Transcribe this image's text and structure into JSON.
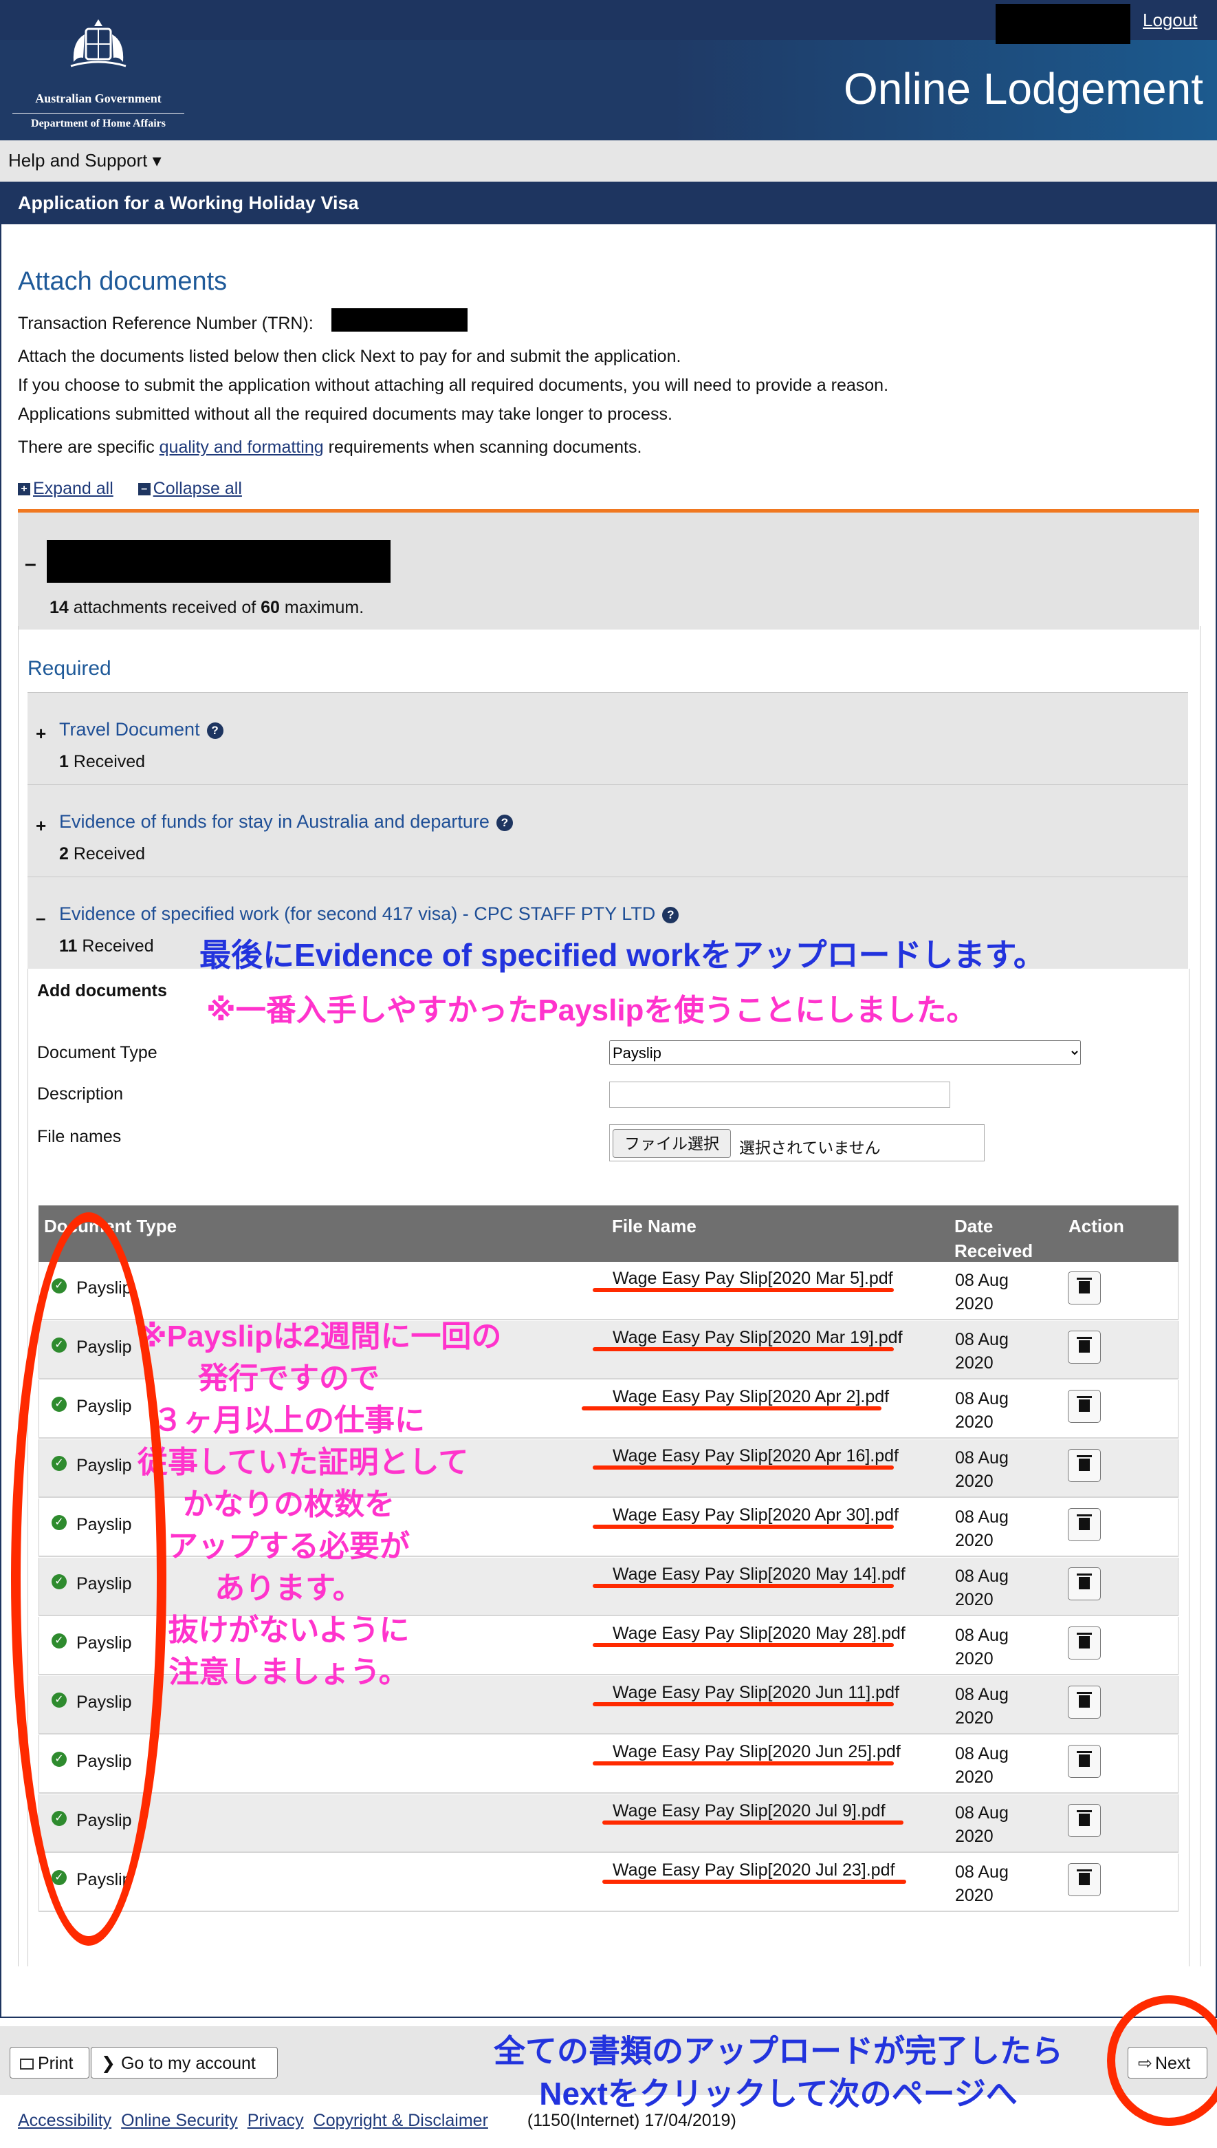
{
  "header": {
    "gov_line1": "Australian Government",
    "gov_line2": "Department of Home Affairs",
    "logout": "Logout",
    "app_title": "Online Lodgement"
  },
  "menu": {
    "help": "Help and Support ▾"
  },
  "appbar": {
    "title": "Application for a Working Holiday Visa"
  },
  "page": {
    "title": "Attach documents",
    "trn_label": "Transaction Reference Number (TRN):",
    "line1": "Attach the documents listed below then click Next to pay for and submit the application.",
    "line2": "If you choose to submit the application without attaching all required documents, you will need to provide a reason.",
    "line3": "Applications submitted without all the required documents may take longer to process.",
    "line4_pre": "There are specific ",
    "line4_link": "quality and formatting",
    "line4_post": " requirements when scanning documents.",
    "expand_all": "Expand all",
    "collapse_all": "Collapse all"
  },
  "applicant": {
    "attach_count": "14",
    "attach_mid": " attachments received of ",
    "attach_max": "60",
    "attach_post": " maximum."
  },
  "required_label": "Required",
  "doc_types": [
    {
      "title": "Travel Document",
      "count": "1",
      "received": " Received",
      "state": "+"
    },
    {
      "title": "Evidence of funds for stay in Australia and departure",
      "count": "2",
      "received": " Received",
      "state": "+"
    },
    {
      "title": "Evidence of specified work (for second 417 visa) - CPC STAFF PTY LTD",
      "count": "11",
      "received": " Received",
      "state": "–"
    }
  ],
  "add_documents": {
    "heading": "Add documents",
    "doc_type_label": "Document Type",
    "doc_type_value": "Payslip",
    "description_label": "Description",
    "file_names_label": "File names",
    "file_button": "ファイル選択",
    "file_status": "選択されていません"
  },
  "table": {
    "headers": {
      "type": "Document Type",
      "file": "File Name",
      "date_1": "Date",
      "date_2": "Received",
      "action": "Action"
    },
    "rows": [
      {
        "type": "Payslip",
        "file": "Wage Easy Pay Slip[2020 Mar 5].pdf",
        "date_1": "08 Aug",
        "date_2": "2020"
      },
      {
        "type": "Payslip",
        "file": "Wage Easy Pay Slip[2020 Mar 19].pdf",
        "date_1": "08 Aug",
        "date_2": "2020"
      },
      {
        "type": "Payslip",
        "file": "Wage Easy Pay Slip[2020 Apr 2].pdf",
        "date_1": "08 Aug",
        "date_2": "2020"
      },
      {
        "type": "Payslip",
        "file": "Wage Easy Pay Slip[2020 Apr 16].pdf",
        "date_1": "08 Aug",
        "date_2": "2020"
      },
      {
        "type": "Payslip",
        "file": "Wage Easy Pay Slip[2020 Apr 30].pdf",
        "date_1": "08 Aug",
        "date_2": "2020"
      },
      {
        "type": "Payslip",
        "file": "Wage Easy Pay Slip[2020 May 14].pdf",
        "date_1": "08 Aug",
        "date_2": "2020"
      },
      {
        "type": "Payslip",
        "file": "Wage Easy Pay Slip[2020 May 28].pdf",
        "date_1": "08 Aug",
        "date_2": "2020"
      },
      {
        "type": "Payslip",
        "file": "Wage Easy Pay Slip[2020 Jun 11].pdf",
        "date_1": "08 Aug",
        "date_2": "2020"
      },
      {
        "type": "Payslip",
        "file": "Wage Easy Pay Slip[2020 Jun 25].pdf",
        "date_1": "08 Aug",
        "date_2": "2020"
      },
      {
        "type": "Payslip",
        "file": "Wage Easy Pay Slip[2020 Jul 9].pdf",
        "date_1": "08 Aug",
        "date_2": "2020"
      },
      {
        "type": "Payslip",
        "file": "Wage Easy Pay Slip[2020 Jul 23].pdf",
        "date_1": "08 Aug",
        "date_2": "2020"
      }
    ]
  },
  "footer": {
    "print": "Print",
    "goto_account": "Go to my account",
    "next": "Next",
    "links": [
      "Accessibility",
      "Online Security",
      "Privacy",
      "Copyright & Disclaimer"
    ],
    "version": "(1150(Internet) 17/04/2019)"
  },
  "annotations": {
    "blue_top": "最後にEvidence of specified workをアップロードします。",
    "pink_top": "※一番入手しやすかったPayslipを使うことにしました。",
    "pink_middle": [
      "※Payslipは2週間に一回の",
      "発行ですので",
      "３ヶ月以上の仕事に",
      "従事していた証明として",
      "かなりの枚数を",
      "アップする必要が",
      "あります。",
      "抜けがないように",
      "注意しましょう。"
    ],
    "blue_bottom": [
      "全ての書類のアップロードが完了したら",
      "Nextをクリックして次のページへ"
    ]
  },
  "colors": {
    "annotation_blue": "#2233dd",
    "annotation_pink": "#ff33cc",
    "annotation_red": "#ff2a00",
    "header_navy": "#1e3560",
    "applicant_accent": "#f07820"
  }
}
